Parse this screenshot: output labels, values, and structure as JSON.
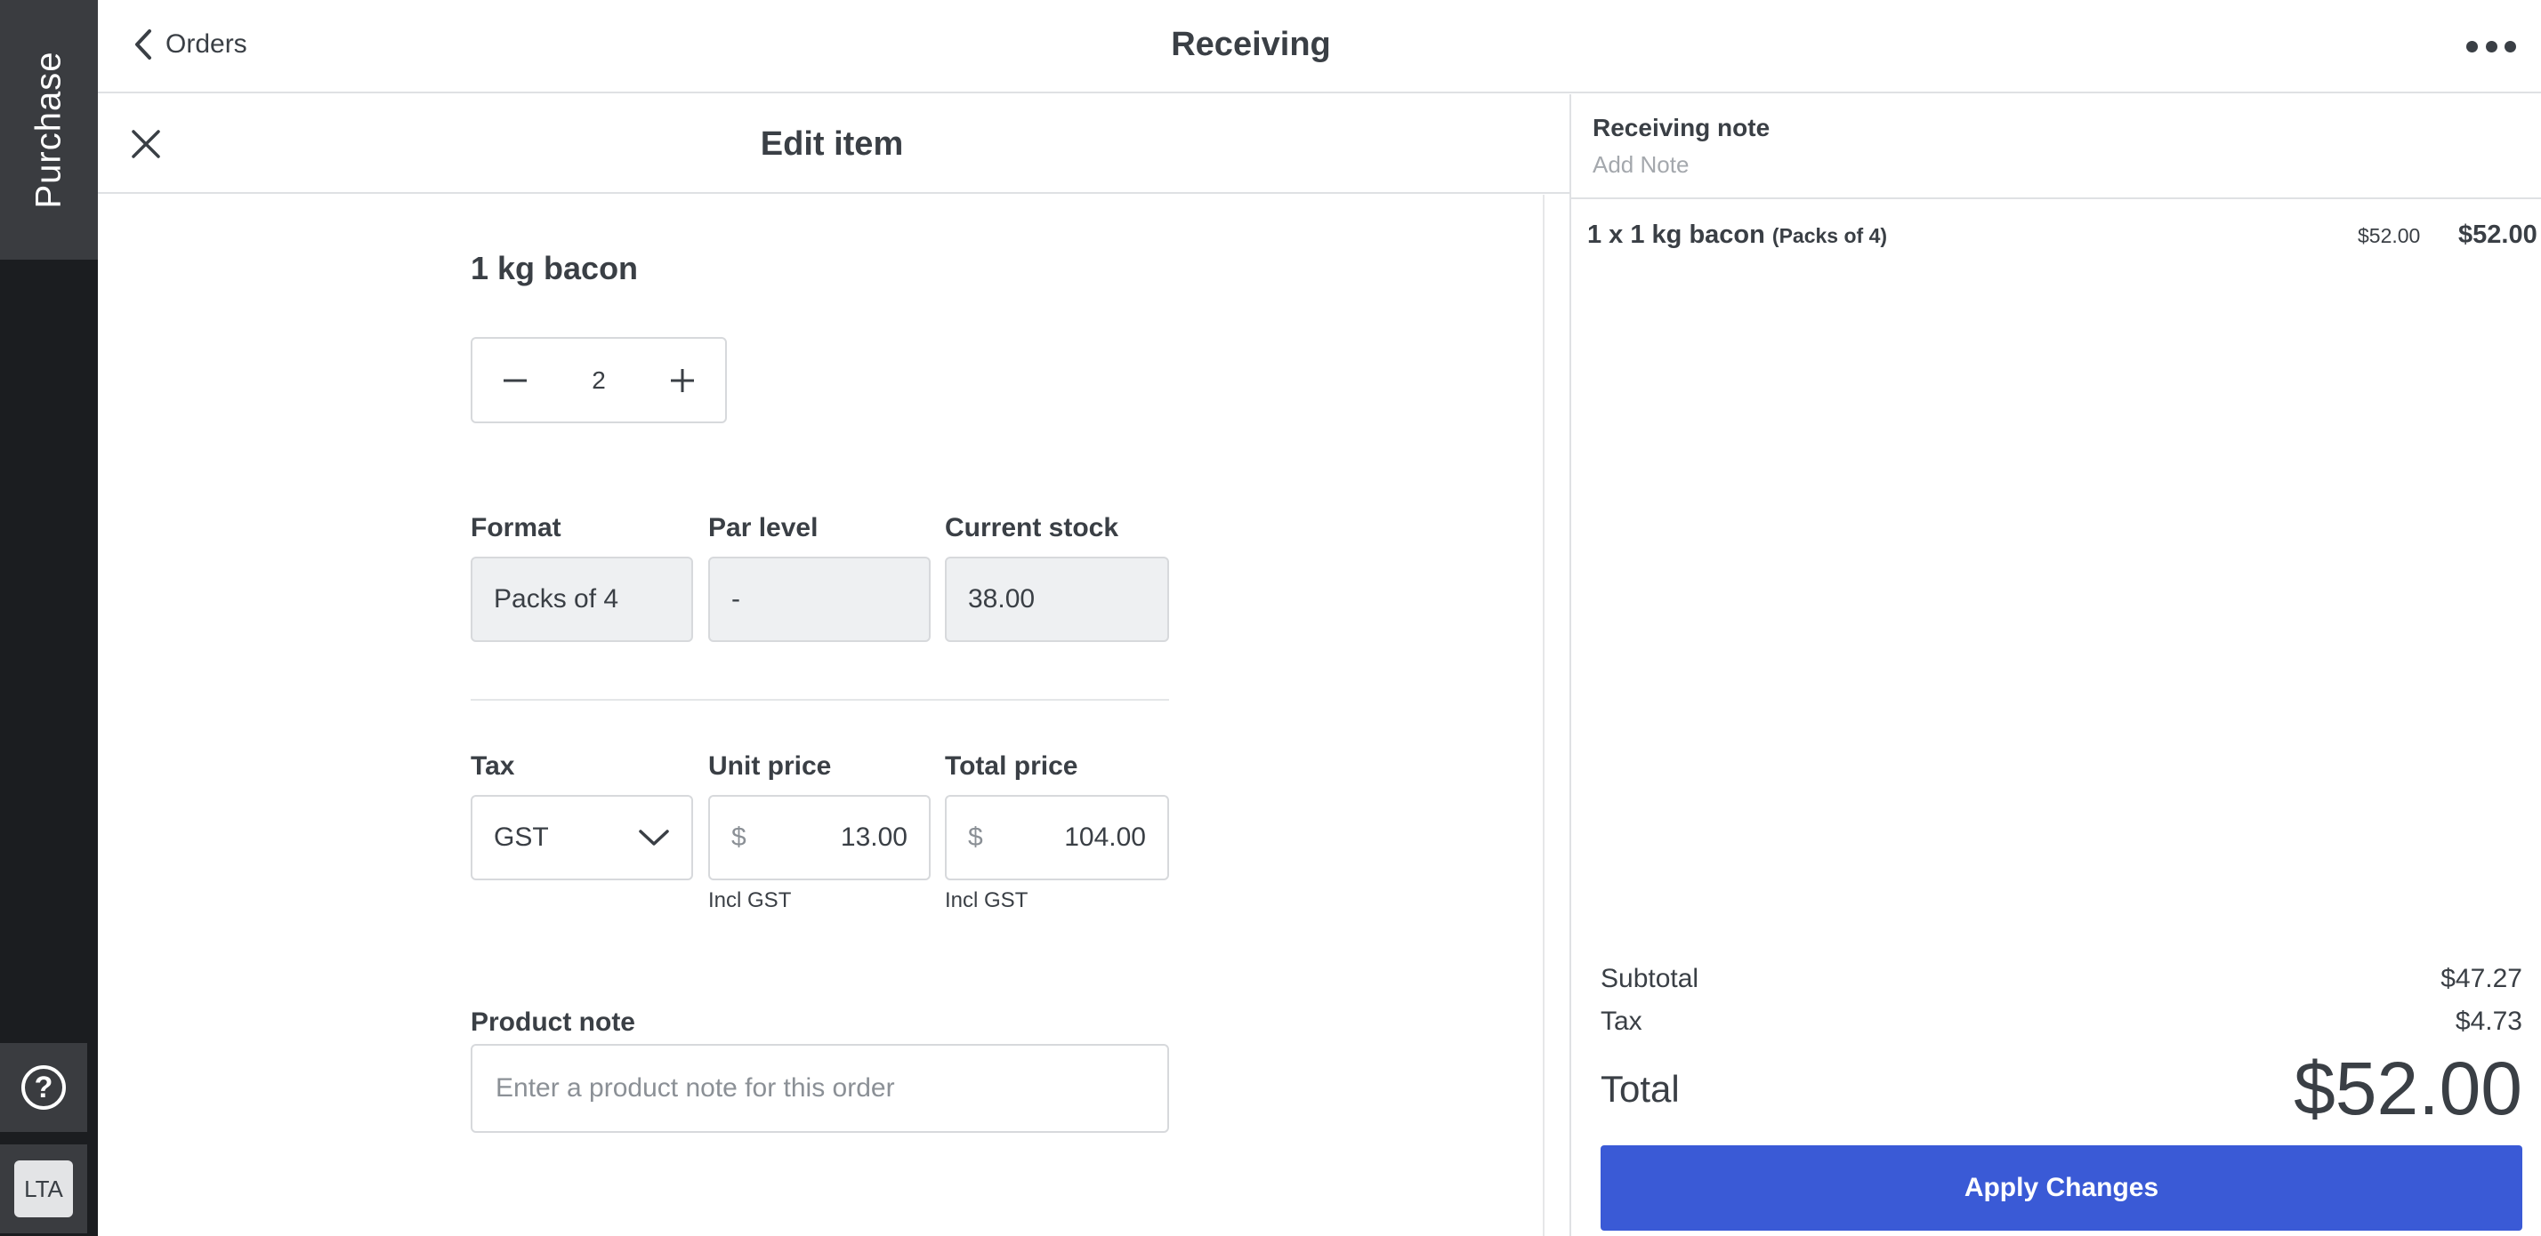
{
  "rail": {
    "tab_label": "Purchase",
    "help_glyph": "?",
    "avatar_initials": "LTA"
  },
  "header": {
    "back_label": "Orders",
    "title": "Receiving",
    "more_icon": "more-horizontal-icon"
  },
  "edit": {
    "title": "Edit item",
    "item_name": "1 kg bacon",
    "quantity": "2",
    "format_label": "Format",
    "format_value": "Packs of 4",
    "par_label": "Par level",
    "par_value": "-",
    "stock_label": "Current stock",
    "stock_value": "38.00",
    "tax_label": "Tax",
    "tax_value": "GST",
    "unit_price_label": "Unit price",
    "unit_price_currency": "$",
    "unit_price_value": "13.00",
    "unit_price_note": "Incl GST",
    "total_price_label": "Total price",
    "total_price_currency": "$",
    "total_price_value": "104.00",
    "total_price_note": "Incl GST",
    "product_note_label": "Product note",
    "product_note_placeholder": "Enter a product note for this order"
  },
  "summary": {
    "receiving_note_label": "Receiving note",
    "receiving_note_placeholder": "Add Note",
    "line": {
      "description": "1 x 1 kg bacon",
      "format": "(Packs of 4)",
      "unit_price": "$52.00",
      "total": "$52.00"
    },
    "subtotal_label": "Subtotal",
    "subtotal_value": "$47.27",
    "tax_label": "Tax",
    "tax_value": "$4.73",
    "total_label": "Total",
    "total_value": "$52.00",
    "apply_label": "Apply Changes"
  },
  "colors": {
    "rail": "#1b1d20",
    "rail_tab": "#3a3c40",
    "accent": "#3a5ad6",
    "text": "#3a3f45",
    "readonly_field": "#eef0f2"
  }
}
